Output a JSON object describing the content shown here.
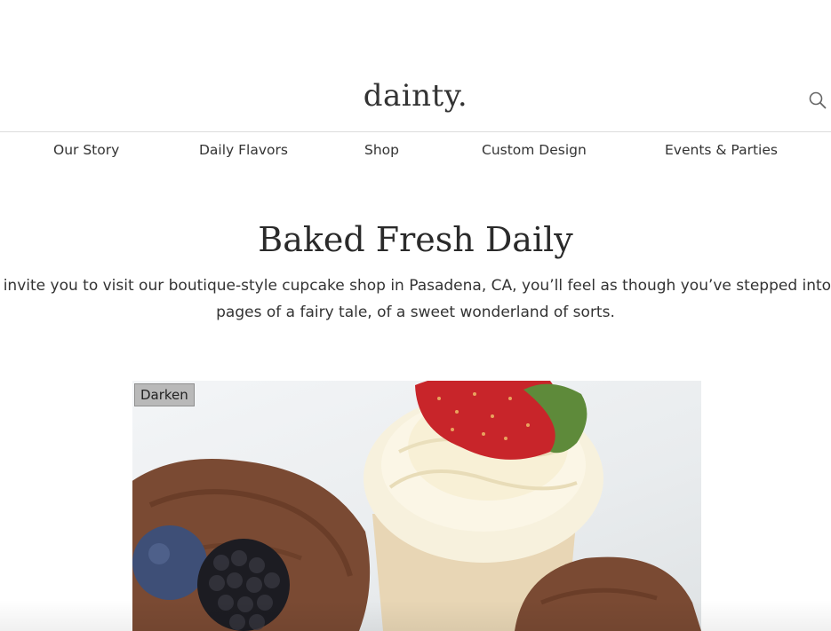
{
  "header": {
    "logo": "dainty.",
    "search_icon": "search-icon"
  },
  "nav": {
    "items": [
      {
        "label": "Our Story"
      },
      {
        "label": "Daily Flavors"
      },
      {
        "label": "Shop"
      },
      {
        "label": "Custom Design"
      },
      {
        "label": "Events & Parties"
      }
    ]
  },
  "main": {
    "headline": "Baked Fresh Daily",
    "intro_line1": "e invite you to visit our boutique-style cupcake shop in Pasadena, CA, you’ll feel as though you’ve stepped into t",
    "intro_line2": "pages of a fairy tale, of a sweet wonderland of sorts."
  },
  "hero": {
    "darken_label": "Darken"
  },
  "colors": {
    "chocolate": "#7a4a33",
    "frosting": "#f6efd8",
    "strawberry": "#c8252a",
    "blueberry": "#3e4f77",
    "blackberry": "#1c1c22"
  }
}
